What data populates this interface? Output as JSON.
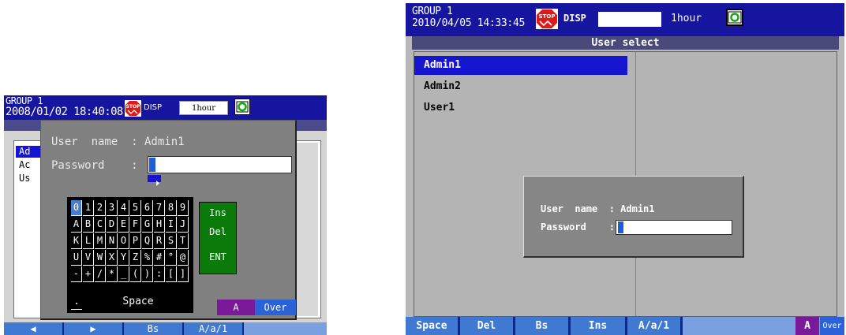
{
  "left_screen": {
    "header": {
      "group": "GROUP 1",
      "datetime": "2008/01/02 18:40:08",
      "stop_icon_label": "STOP",
      "disp": "DISP",
      "trend_interval": "1hour"
    },
    "list_items": [
      "Ad",
      "Ac",
      "Us"
    ],
    "dialog": {
      "user_label": "User  name  : Admin1",
      "password_label": "Password    :"
    },
    "keyboard": {
      "rows": [
        [
          "0",
          "1",
          "2",
          "3",
          "4",
          "5",
          "6",
          "7",
          "8",
          "9"
        ],
        [
          "A",
          "B",
          "C",
          "D",
          "E",
          "F",
          "G",
          "H",
          "I",
          "J"
        ],
        [
          "K",
          "L",
          "M",
          "N",
          "O",
          "P",
          "Q",
          "R",
          "S",
          "T"
        ],
        [
          "U",
          "V",
          "W",
          "X",
          "Y",
          "Z",
          "%",
          "#",
          "°",
          "@"
        ],
        [
          "-",
          "+",
          "/",
          "*",
          "_",
          "(",
          ")",
          ":",
          "[",
          "]"
        ]
      ],
      "period": ".",
      "space": "Space",
      "ins": "Ins",
      "del": "Del",
      "ent": "ENT"
    },
    "mode": {
      "a": "A",
      "over": "Over"
    },
    "function_bar": [
      "◀",
      "▶",
      "Bs",
      "A/a/1"
    ]
  },
  "right_screen": {
    "header": {
      "group": "GROUP 1",
      "datetime": "2010/04/05 14:33:45",
      "stop_icon_label": "STOP",
      "disp": "DISP",
      "trend_interval": "1hour"
    },
    "title": "User select",
    "list_items": [
      "Admin1",
      "Admin2",
      "User1"
    ],
    "dialog": {
      "user_label": "User  name  : Admin1",
      "password_label": "Password    :"
    },
    "function_bar": [
      "Space",
      "Del",
      "Bs",
      "Ins",
      "A/a/1"
    ],
    "mode": {
      "a": "A",
      "over": "Over"
    }
  },
  "colors": {
    "header_blue": "#1515a0",
    "selected_blue": "#1515d0",
    "function_key_blue": "#3f79d2",
    "mode_purple": "#7a1a9a",
    "stop_red": "#e01818",
    "fkey_green": "#0a7a0a"
  }
}
